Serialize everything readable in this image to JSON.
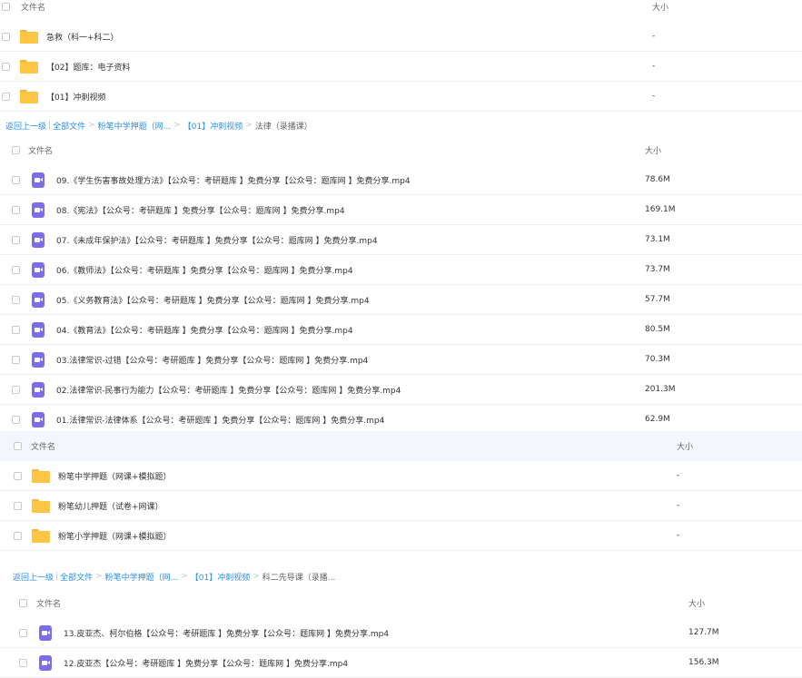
{
  "columns": {
    "name": "文件名",
    "size": "大小"
  },
  "p1": {
    "rows": [
      {
        "name": "急救（科一+科二）",
        "size": "-"
      },
      {
        "name": "【02】题库：电子资料",
        "size": "-"
      },
      {
        "name": "【01】冲刺视频",
        "size": "-"
      }
    ]
  },
  "crumb1": {
    "back": "返回上一级",
    "all": "全部文件",
    "c1": "粉笔中学押题（网...",
    "c2": "【01】冲刺视频",
    "current": "法律（录播课）"
  },
  "p2": {
    "rows": [
      {
        "name": "09.《学生伤害事故处理方法》【公众号：考研题库 】免费分享【公众号：题库网 】免费分享.mp4",
        "size": "78.6M"
      },
      {
        "name": "08.《宪法》【公众号：考研题库 】免费分享【公众号：题库网 】免费分享.mp4",
        "size": "169.1M"
      },
      {
        "name": "07.《未成年保护法》【公众号：考研题库 】免费分享【公众号：题库网 】免费分享.mp4",
        "size": "73.1M"
      },
      {
        "name": "06.《教师法》【公众号：考研题库 】免费分享【公众号：题库网 】免费分享.mp4",
        "size": "73.7M"
      },
      {
        "name": "05.《义务教育法》【公众号：考研题库 】免费分享【公众号：题库网 】免费分享.mp4",
        "size": "57.7M"
      },
      {
        "name": "04.《教育法》【公众号：考研题库 】免费分享【公众号：题库网 】免费分享.mp4",
        "size": "80.5M"
      },
      {
        "name": "03.法律常识-过错【公众号：考研题库 】免费分享【公众号：题库网 】免费分享.mp4",
        "size": "70.3M"
      },
      {
        "name": "02.法律常识-民事行为能力【公众号：考研题库 】免费分享【公众号：题库网 】免费分享.mp4",
        "size": "201.3M"
      },
      {
        "name": "01.法律常识-法律体系【公众号：考研题库 】免费分享【公众号：题库网 】免费分享.mp4",
        "size": "62.9M"
      }
    ]
  },
  "p3": {
    "rows": [
      {
        "name": "粉笔中学押题（网课+模拟题）",
        "size": "-"
      },
      {
        "name": "粉笔幼儿押题（试卷+网课）",
        "size": "-"
      },
      {
        "name": "粉笔小学押题（网课+模拟题）",
        "size": "-"
      }
    ]
  },
  "crumb2": {
    "back": "返回上一级",
    "all": "全部文件",
    "c1": "粉笔中学押题（网...",
    "c2": "【01】冲刺视频",
    "current": "科二先导课（录播..."
  },
  "p4": {
    "rows": [
      {
        "name": "13.皮亚杰、柯尔伯格【公众号：考研题库 】免费分享【公众号：题库网 】免费分享.mp4",
        "size": "127.7M"
      },
      {
        "name": "12.皮亚杰【公众号：考研题库 】免费分享【公众号：题库网 】免费分享.mp4",
        "size": "156.3M"
      }
    ]
  }
}
